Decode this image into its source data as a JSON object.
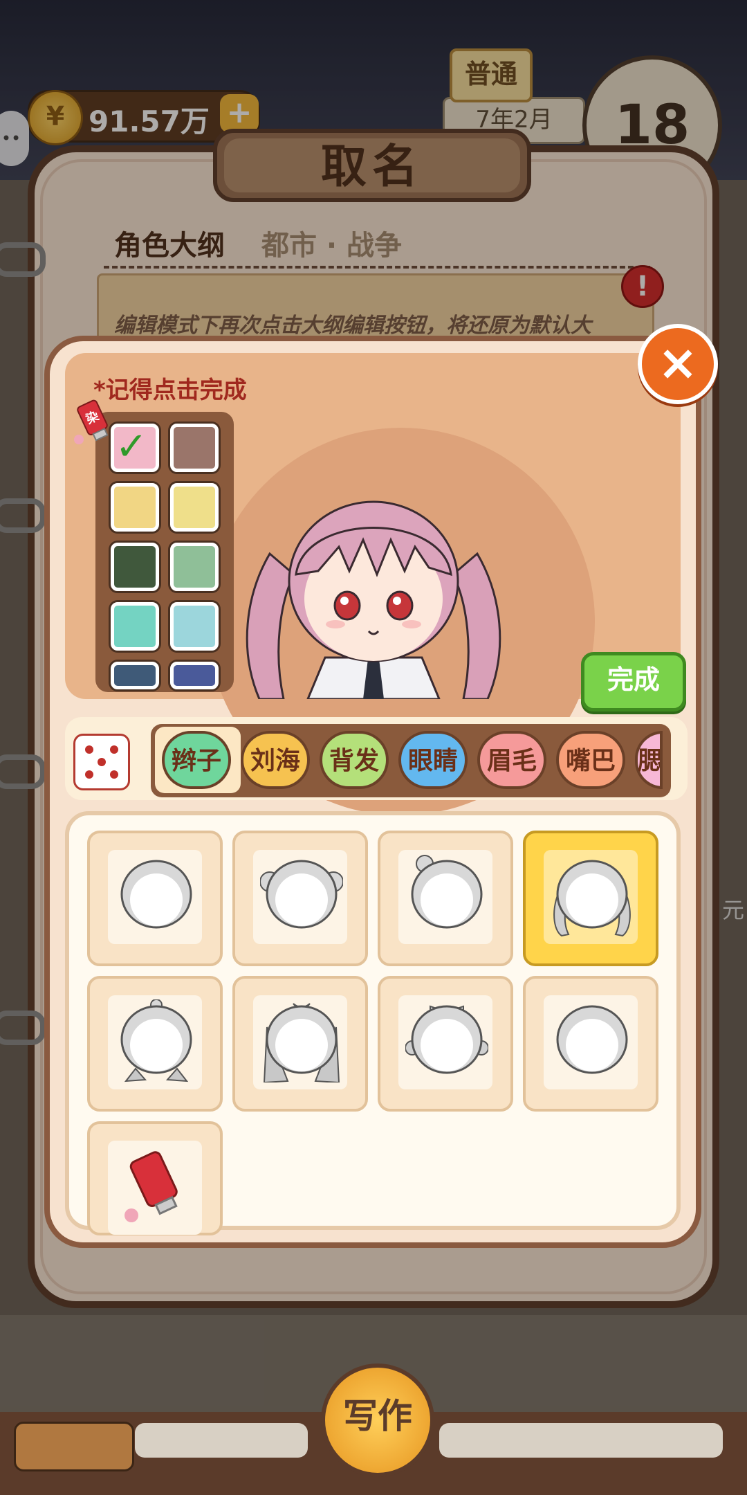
{
  "hud": {
    "coins": "91.57万",
    "coin_plus": "+",
    "coin_symbol": "¥",
    "mode": "普通",
    "date": "7年2月",
    "day": "18",
    "side_hint": "元"
  },
  "book": {
    "title": "取名",
    "outline_label": "角色大纲",
    "outline_value": "都市 · 战争",
    "outline_hint": "编辑模式下再次点击大纲编辑按钮，将还原为默认大",
    "warning_icon": "!"
  },
  "customizer": {
    "close_icon": "×",
    "reminder": "*记得点击完成",
    "done_label": "完成",
    "palette": [
      {
        "color": "#f2b8c8",
        "selected": true
      },
      {
        "color": "#9a756a",
        "selected": false
      },
      {
        "color": "#f1d684",
        "selected": false
      },
      {
        "color": "#efdf8a",
        "selected": false
      },
      {
        "color": "#40583c",
        "selected": false
      },
      {
        "color": "#8fbf98",
        "selected": false
      },
      {
        "color": "#74d3c2",
        "selected": false
      },
      {
        "color": "#9cd6dc",
        "selected": false
      },
      {
        "color": "#3f5a78",
        "selected": false
      },
      {
        "color": "#4a5a9a",
        "selected": false
      }
    ],
    "dye_icon_label": "染",
    "tabs": [
      {
        "label": "辫子",
        "color": "#6fd69c",
        "selected": true
      },
      {
        "label": "刘海",
        "color": "#f6c250",
        "selected": false
      },
      {
        "label": "背发",
        "color": "#b4e07a",
        "selected": false
      },
      {
        "label": "眼睛",
        "color": "#63b8ef",
        "selected": false
      },
      {
        "label": "眉毛",
        "color": "#f59a9a",
        "selected": false
      },
      {
        "label": "嘴巴",
        "color": "#f7a07a",
        "selected": false
      },
      {
        "label": "腮",
        "color": "#f7b8d6",
        "selected": false
      }
    ],
    "hair_styles": [
      {
        "id": "none",
        "selected": false
      },
      {
        "id": "side-buns",
        "selected": false
      },
      {
        "id": "single-bun",
        "selected": false
      },
      {
        "id": "twin-tails",
        "selected": true
      },
      {
        "id": "low-tails",
        "selected": false
      },
      {
        "id": "ribbon-long",
        "selected": false
      },
      {
        "id": "bow-braids",
        "selected": false
      },
      {
        "id": "plain",
        "selected": false
      },
      {
        "id": "dye",
        "selected": false
      }
    ]
  },
  "bottom": {
    "write_label": "写作"
  },
  "icons": {
    "coin": "coin-icon",
    "plus": "plus-icon",
    "warning": "warning-icon",
    "close": "close-icon",
    "dice": "dice-icon",
    "dye": "dye-tube-icon",
    "check": "check-icon"
  }
}
